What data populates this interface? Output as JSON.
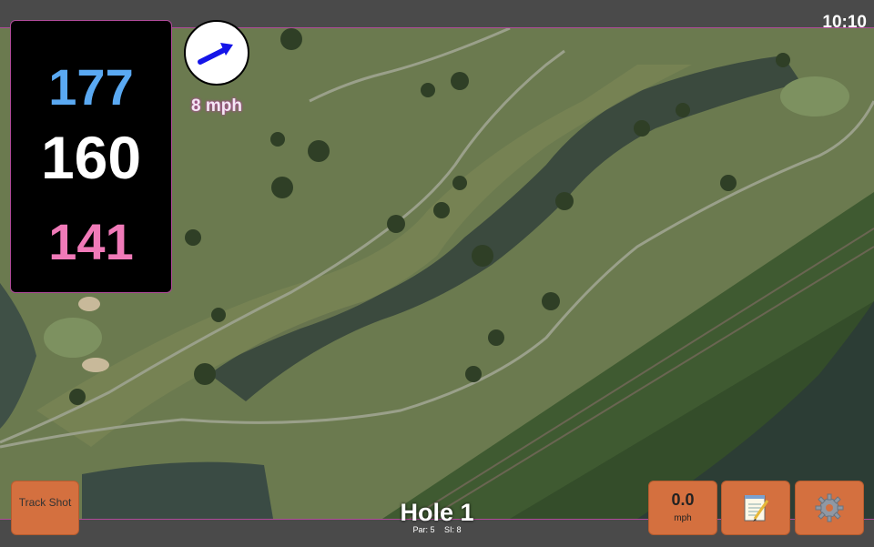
{
  "status": {
    "time": "10:10"
  },
  "distances": {
    "back": "177",
    "middle": "160",
    "front": "141"
  },
  "wind": {
    "speed": "8 mph",
    "icon": "arrow-icon",
    "arrow_color": "#1515e8"
  },
  "hole": {
    "title": "Hole 1",
    "par": "Par: 5",
    "si": "SI: 8"
  },
  "buttons": {
    "track_shot": "Track Shot",
    "speed_value": "0.0",
    "speed_unit": "mph",
    "notes_icon": "notepad-icon",
    "settings_icon": "gear-icon"
  },
  "colors": {
    "accent_border": "#b04a9a",
    "button": "#d4703f",
    "back_distance": "#5aa9f2",
    "front_distance": "#f07ab8"
  }
}
